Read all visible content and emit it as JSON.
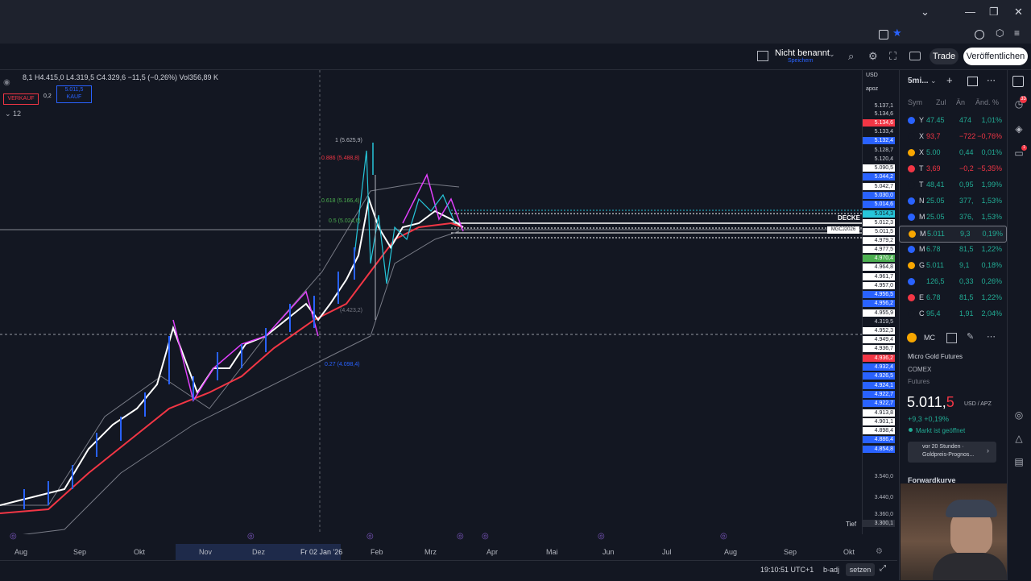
{
  "window": {
    "controls": [
      "⌄",
      "—",
      "❐",
      "✕"
    ]
  },
  "toolbar": {
    "layout_name": "Nicht benannt",
    "layout_sub": "Speichern",
    "trade_label": "Trade",
    "publish_label": "Veröffentlichen"
  },
  "chart": {
    "legend": "8,1  H4.415,0  L4.319,5  C4.329,6  −11,5 (−0,26%)  Vol356,89 K",
    "sell_label": "VERKAUF",
    "buy_label": "5.011,5",
    "buy_sub": "KAUF",
    "spread": "0,2",
    "indicator_count": "12",
    "fib_levels": [
      {
        "label": "1 (5.625,9)",
        "color": "#b2b5be"
      },
      {
        "label": "0.886 (5.488,8)",
        "color": "#f23645"
      },
      {
        "label": "0.618 (5.166,4)",
        "color": "#4caf50"
      },
      {
        "label": "0.5 (5.024,6)",
        "color": "#4caf50"
      },
      {
        "label": "0.27 (4.098,4)",
        "color": "#2962ff"
      },
      {
        "label": "(4.423,2)",
        "color": "#787b86"
      }
    ],
    "decke_label": "DECKE",
    "mgc_label": "MGCJ2026",
    "low_label": "Tief",
    "low_value": "3.300,1",
    "currency": "USD",
    "unit": "apoz"
  },
  "price_axis": [
    {
      "v": "5.137,1",
      "bg": "#131722",
      "fg": "#d1d4dc"
    },
    {
      "v": "5.134,6",
      "bg": "#131722",
      "fg": "#d1d4dc"
    },
    {
      "v": "5.134,6",
      "bg": "#f23645",
      "fg": "#ffffff"
    },
    {
      "v": "5.133,4",
      "bg": "#131722",
      "fg": "#d1d4dc"
    },
    {
      "v": "5.132,4",
      "bg": "#2962ff",
      "fg": "#ffffff"
    },
    {
      "v": "5.128,7",
      "bg": "#131722",
      "fg": "#d1d4dc"
    },
    {
      "v": "5.120,4",
      "bg": "#131722",
      "fg": "#d1d4dc"
    },
    {
      "v": "5.090,5",
      "bg": "#ffffff",
      "fg": "#131722"
    },
    {
      "v": "5.044,2",
      "bg": "#2962ff",
      "fg": "#ffffff"
    },
    {
      "v": "5.042,7",
      "bg": "#ffffff",
      "fg": "#131722"
    },
    {
      "v": "5.030,0",
      "bg": "#2962ff",
      "fg": "#ffffff"
    },
    {
      "v": "5.014,6",
      "bg": "#2962ff",
      "fg": "#ffffff"
    },
    {
      "v": "5.014,3",
      "bg": "#26c6da",
      "fg": "#131722"
    },
    {
      "v": "5.012,3",
      "bg": "#ffffff",
      "fg": "#131722"
    },
    {
      "v": "5.011,5",
      "bg": "#ffffff",
      "fg": "#131722"
    },
    {
      "v": "4.979,2",
      "bg": "#ffffff",
      "fg": "#131722"
    },
    {
      "v": "4.977,5",
      "bg": "#ffffff",
      "fg": "#131722"
    },
    {
      "v": "4.970,4",
      "bg": "#4caf50",
      "fg": "#ffffff"
    },
    {
      "v": "4.964,8",
      "bg": "#ffffff",
      "fg": "#131722"
    },
    {
      "v": "4.961,7",
      "bg": "#ffffff",
      "fg": "#131722"
    },
    {
      "v": "4.957,0",
      "bg": "#ffffff",
      "fg": "#131722"
    },
    {
      "v": "4.956,5",
      "bg": "#2962ff",
      "fg": "#ffffff"
    },
    {
      "v": "4.956,2",
      "bg": "#2962ff",
      "fg": "#ffffff"
    },
    {
      "v": "4.955,9",
      "bg": "#ffffff",
      "fg": "#131722"
    },
    {
      "v": "4.319,5",
      "bg": "#131722",
      "fg": "#d1d4dc"
    },
    {
      "v": "4.952,3",
      "bg": "#ffffff",
      "fg": "#131722"
    },
    {
      "v": "4.949,4",
      "bg": "#ffffff",
      "fg": "#131722"
    },
    {
      "v": "4.936,7",
      "bg": "#ffffff",
      "fg": "#131722"
    },
    {
      "v": "4.936,2",
      "bg": "#f23645",
      "fg": "#ffffff"
    },
    {
      "v": "4.932,4",
      "bg": "#2962ff",
      "fg": "#ffffff"
    },
    {
      "v": "4.926,5",
      "bg": "#2962ff",
      "fg": "#ffffff"
    },
    {
      "v": "4.924,1",
      "bg": "#2962ff",
      "fg": "#ffffff"
    },
    {
      "v": "4.922,7",
      "bg": "#2962ff",
      "fg": "#ffffff"
    },
    {
      "v": "4.922,7",
      "bg": "#2962ff",
      "fg": "#ffffff"
    },
    {
      "v": "4.913,8",
      "bg": "#ffffff",
      "fg": "#131722"
    },
    {
      "v": "4.901,1",
      "bg": "#ffffff",
      "fg": "#131722"
    },
    {
      "v": "4.898,4",
      "bg": "#ffffff",
      "fg": "#131722"
    },
    {
      "v": "4.886,4",
      "bg": "#2962ff",
      "fg": "#ffffff"
    },
    {
      "v": "4.854,8",
      "bg": "#2962ff",
      "fg": "#ffffff"
    },
    {
      "v": "3.540,0",
      "bg": "#131722",
      "fg": "#b2b5be"
    },
    {
      "v": "3.440,0",
      "bg": "#131722",
      "fg": "#b2b5be"
    },
    {
      "v": "3.360,0",
      "bg": "#131722",
      "fg": "#b2b5be"
    }
  ],
  "time_axis": [
    "Aug",
    "Sep",
    "Okt",
    "Nov",
    "Dez",
    "Fr 02 Jan '26",
    "Feb",
    "Mrz",
    "Apr",
    "Mai",
    "Jun",
    "Jul",
    "Aug",
    "Sep",
    "Okt"
  ],
  "status": {
    "time": "19:10:51 UTC+1",
    "adj": "b-adj",
    "setzen": "setzen"
  },
  "watchlist": {
    "title": "5mi...",
    "headers": [
      "Sym",
      "Zul",
      "Än",
      "Änd. %"
    ],
    "rows": [
      {
        "icon": "#2962ff",
        "sym": "Y",
        "last": "47.45",
        "chg": "474",
        "pct": "1,01%",
        "dir": "up"
      },
      {
        "icon": "#131722",
        "sym": "X",
        "last": "93,7",
        "chg": "−722",
        "pct": "−0,76%",
        "dir": "down"
      },
      {
        "icon": "#f7a600",
        "sym": "X",
        "last": "5.00",
        "chg": "0,44",
        "pct": "0,01%",
        "dir": "up"
      },
      {
        "icon": "#f23645",
        "sym": "T",
        "last": "3,69",
        "chg": "−0,2",
        "pct": "−5,35%",
        "dir": "down"
      },
      {
        "icon": "#131722",
        "sym": "T",
        "last": "48,41",
        "chg": "0,95",
        "pct": "1,99%",
        "dir": "up"
      },
      {
        "icon": "#2962ff",
        "sym": "N",
        "last": "25.05",
        "chg": "377,",
        "pct": "1,53%",
        "dir": "up"
      },
      {
        "icon": "#2962ff",
        "sym": "M",
        "last": "25.05",
        "chg": "376,",
        "pct": "1,53%",
        "dir": "up"
      },
      {
        "icon": "#f7a600",
        "sym": "M",
        "last": "5.011",
        "chg": "9,3",
        "pct": "0,19%",
        "dir": "up"
      },
      {
        "icon": "#2962ff",
        "sym": "M",
        "last": "6.78",
        "chg": "81,5",
        "pct": "1,22%",
        "dir": "up"
      },
      {
        "icon": "#f7a600",
        "sym": "G",
        "last": "5.011",
        "chg": "9,1",
        "pct": "0,18%",
        "dir": "up"
      },
      {
        "icon": "#2962ff",
        "sym": "",
        "last": "126,5",
        "chg": "0,33",
        "pct": "0,26%",
        "dir": "up"
      },
      {
        "icon": "#f23645",
        "sym": "E",
        "last": "6.78",
        "chg": "81,5",
        "pct": "1,22%",
        "dir": "up"
      },
      {
        "icon": "#131722",
        "sym": "C",
        "last": "95,4",
        "chg": "1,91",
        "pct": "2,04%",
        "dir": "up"
      }
    ]
  },
  "symbol": {
    "short": "MC",
    "name": "Micro Gold Futures",
    "exchange": "COMEX",
    "type": "Futures",
    "price_main": "5.011,",
    "price_tail": "5",
    "currency": "USD / APZ",
    "change": "+9,3  +0,19%",
    "market_status": "Markt ist geöffnet",
    "news_line1": "vor 20 Stunden ·",
    "news_line2": "Goldpreis-Prognos...",
    "forward_curve": "Forwardkurve"
  },
  "colors": {
    "up": "#22ab94",
    "down": "#f23645",
    "accent": "#2962ff"
  }
}
